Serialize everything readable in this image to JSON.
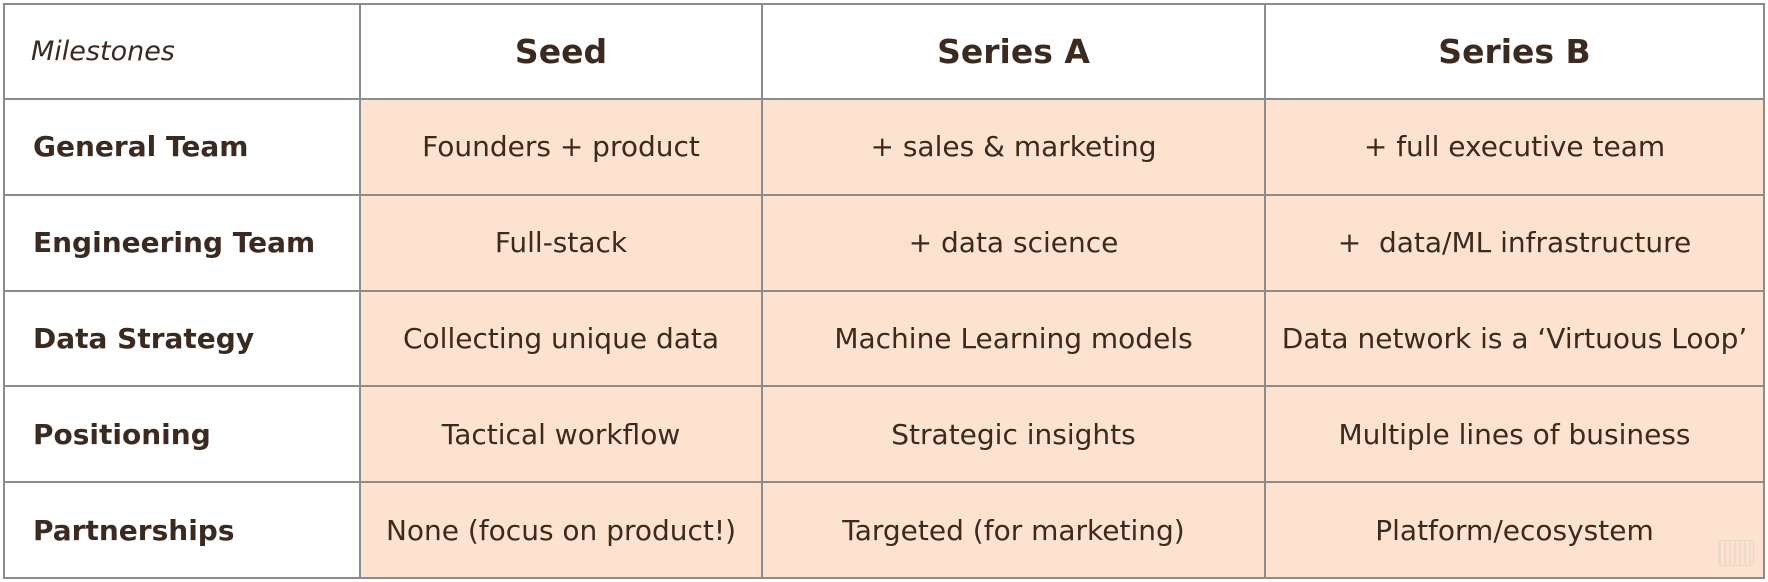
{
  "table": {
    "corner_label": "Milestones",
    "columns": [
      "Seed",
      "Series A",
      "Series B"
    ],
    "rows": [
      {
        "label": "General Team",
        "cells": [
          "Founders + product",
          "+ sales & marketing",
          "+ full executive team"
        ]
      },
      {
        "label": "Engineering Team",
        "cells": [
          "Full-stack",
          "+ data science",
          "+  data/ML infrastructure"
        ]
      },
      {
        "label": "Data Strategy",
        "cells": [
          "Collecting unique data",
          "Machine Learning models",
          "Data network is a ‘Virtuous Loop’"
        ]
      },
      {
        "label": "Positioning",
        "cells": [
          "Tactical workflow",
          "Strategic insights",
          "Multiple lines of business"
        ]
      },
      {
        "label": "Partnerships",
        "cells": [
          "None (focus on product!)",
          "Targeted (for marketing)",
          "Platform/ecosystem"
        ]
      }
    ]
  },
  "colors": {
    "cell_fill": "#fde3cf",
    "border": "#8c8c8c",
    "text": "#3b2a1f"
  }
}
